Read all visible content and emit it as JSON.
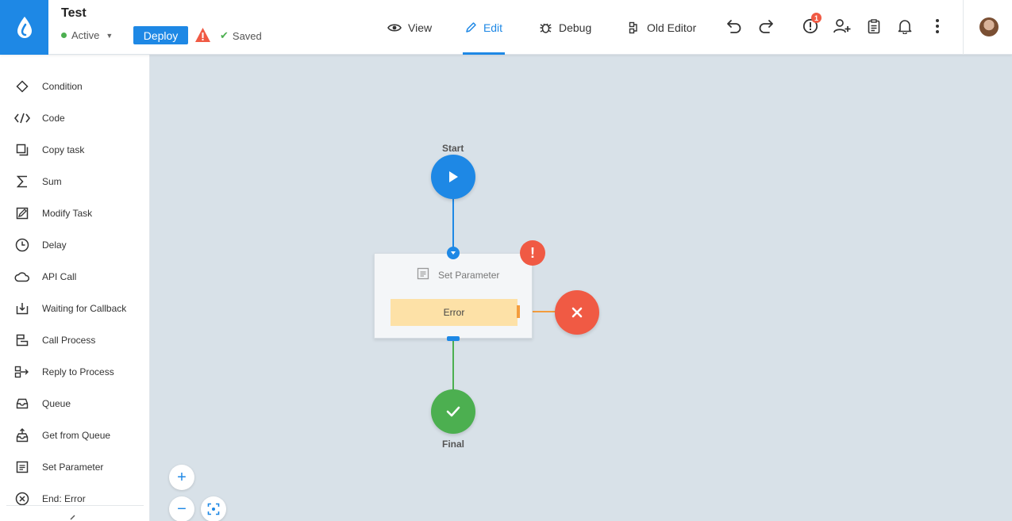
{
  "header": {
    "title": "Test",
    "status": "Active",
    "deploy_label": "Deploy",
    "saved_label": "Saved",
    "tabs": [
      {
        "label": "View",
        "icon": "eye-icon"
      },
      {
        "label": "Edit",
        "icon": "pencil-icon",
        "active": true
      },
      {
        "label": "Debug",
        "icon": "bug-icon"
      },
      {
        "label": "Old Editor",
        "icon": "old-editor-icon"
      }
    ],
    "notification_badge": "1",
    "colors": {
      "accent": "#1e88e5",
      "danger": "#f05a44",
      "success": "#4caf50"
    }
  },
  "sidebar": {
    "items": [
      {
        "label": "Condition",
        "icon": "diamond-icon"
      },
      {
        "label": "Code",
        "icon": "code-icon"
      },
      {
        "label": "Copy task",
        "icon": "copy-icon"
      },
      {
        "label": "Sum",
        "icon": "sigma-icon"
      },
      {
        "label": "Modify Task",
        "icon": "edit-square-icon"
      },
      {
        "label": "Delay",
        "icon": "clock-icon"
      },
      {
        "label": "API Call",
        "icon": "cloud-icon"
      },
      {
        "label": "Waiting for Callback",
        "icon": "download-tray-icon"
      },
      {
        "label": "Call Process",
        "icon": "call-process-icon"
      },
      {
        "label": "Reply to Process",
        "icon": "reply-process-icon"
      },
      {
        "label": "Queue",
        "icon": "inbox-icon"
      },
      {
        "label": "Get from Queue",
        "icon": "upload-tray-icon"
      },
      {
        "label": "Set Parameter",
        "icon": "list-icon"
      },
      {
        "label": "End: Error",
        "icon": "x-circle-icon"
      }
    ]
  },
  "canvas": {
    "start_label": "Start",
    "final_label": "Final",
    "task": {
      "title": "Set Parameter",
      "condition_label": "Error"
    },
    "warning_mark": "!"
  },
  "zoom": {
    "in": "+",
    "out": "−"
  }
}
